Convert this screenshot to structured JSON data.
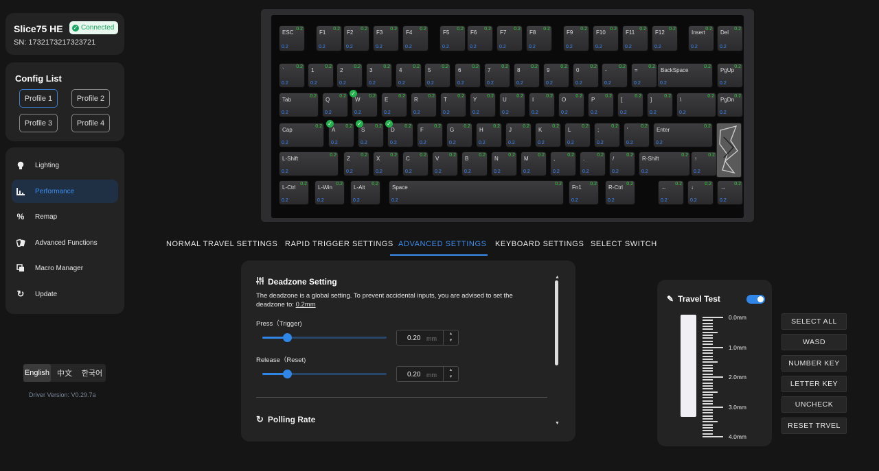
{
  "device": {
    "name": "Slice75 HE",
    "status": "Connected",
    "sn": "SN: 1732173217323721"
  },
  "config": {
    "title": "Config List",
    "profiles": [
      "Profile 1",
      "Profile 2",
      "Profile 3",
      "Profile 4"
    ],
    "active": "Profile 1"
  },
  "nav": {
    "items": [
      {
        "label": "Lighting",
        "icon": "bulb-icon"
      },
      {
        "label": "Performance",
        "icon": "bar-chart-icon"
      },
      {
        "label": "Remap",
        "icon": "remap-icon"
      },
      {
        "label": "Advanced Functions",
        "icon": "cards-icon"
      },
      {
        "label": "Macro Manager",
        "icon": "macro-icon"
      },
      {
        "label": "Update",
        "icon": "refresh-icon"
      }
    ],
    "active": "Performance"
  },
  "language": {
    "options": [
      "English",
      "中文",
      "한국어"
    ],
    "selected": "English"
  },
  "driver_version": "Driver Version: V0.29.7a",
  "keyboard": {
    "travel_label": "0.2",
    "rows": [
      [
        "ESC",
        "F1",
        "F2",
        "F3",
        "F4",
        "F5",
        "F6",
        "F7",
        "F8",
        "F9",
        "F10",
        "F11",
        "F12",
        "Insert",
        "Del"
      ],
      [
        "`",
        "1",
        "2",
        "3",
        "4",
        "5",
        "6",
        "7",
        "8",
        "9",
        "0",
        "-",
        "=",
        "BackSpace",
        "PgUp"
      ],
      [
        "Tab",
        "Q",
        "W",
        "E",
        "R",
        "T",
        "Y",
        "U",
        "I",
        "O",
        "P",
        "[",
        "]",
        "\\",
        "PgDn"
      ],
      [
        "Cap",
        "A",
        "S",
        "D",
        "F",
        "G",
        "H",
        "J",
        "K",
        "L",
        ";",
        "'",
        "Enter"
      ],
      [
        "L-Shift",
        "Z",
        "X",
        "C",
        "V",
        "B",
        "N",
        "M",
        ",",
        ".",
        "/",
        "R-Shift",
        "↑"
      ],
      [
        "L-Ctrl",
        "L-Win",
        "L-Alt",
        "Space",
        "Fn1",
        "R-Ctrl",
        "←",
        "↓",
        "→"
      ]
    ],
    "selected_keys": [
      "W",
      "A",
      "S",
      "D"
    ]
  },
  "tabs": [
    "NORMAL TRAVEL SETTINGS",
    "RAPID TRIGGER SETTINGS",
    "ADVANCED SETTINGS",
    "KEYBOARD SETTINGS",
    "SELECT SWITCH"
  ],
  "active_tab": "ADVANCED SETTINGS",
  "deadzone": {
    "title": "Deadzone Setting",
    "desc": "The deadzone is a global setting. To prevent accidental inputs, you are advised to set the deadzone to:",
    "recommended": "0.2mm",
    "press_label": "Press（Trigger)",
    "press_value": "0.20",
    "release_label": "Release（Reset)",
    "release_value": "0.20",
    "unit": "mm",
    "press_fraction": 0.2,
    "release_fraction": 0.2
  },
  "polling": {
    "title": "Polling Rate"
  },
  "travel_test": {
    "title": "Travel Test",
    "enabled": true,
    "scale": [
      "0.0mm",
      "1.0mm",
      "2.0mm",
      "3.0mm",
      "4.0mm"
    ],
    "level": 0
  },
  "quick_buttons": [
    "SELECT ALL",
    "WASD",
    "NUMBER KEY",
    "LETTER KEY",
    "UNCHECK",
    "RESET TRVEL"
  ]
}
